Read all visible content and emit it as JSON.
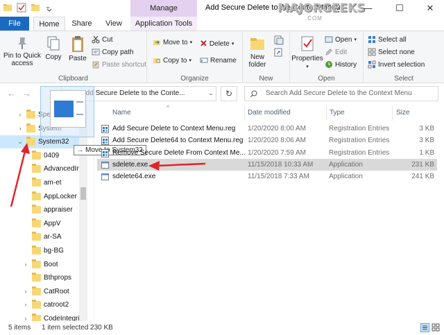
{
  "window": {
    "title": "Add Secure Delete to the Context Menu",
    "context_tab": "Manage",
    "watermark": "MAJORGEEKS",
    "watermark_sub": ".COM",
    "minimize": "—",
    "maximize": "☐",
    "close": "✕"
  },
  "tabs": {
    "file": "File",
    "home": "Home",
    "share": "Share",
    "view": "View",
    "app_tools": "Application Tools"
  },
  "ribbon": {
    "clipboard": {
      "label": "Clipboard",
      "pin": "Pin to Quick access",
      "copy": "Copy",
      "paste": "Paste",
      "cut": "Cut",
      "copy_path": "Copy path",
      "paste_shortcut": "Paste shortcut"
    },
    "organize": {
      "label": "Organize",
      "move_to": "Move to",
      "copy_to": "Copy to",
      "delete": "Delete",
      "rename": "Rename"
    },
    "new": {
      "label": "New",
      "new_folder": "New folder"
    },
    "open": {
      "label": "Open",
      "properties": "Properties",
      "open": "Open",
      "edit": "Edit",
      "history": "History"
    },
    "select": {
      "label": "Select",
      "select_all": "Select all",
      "select_none": "Select none",
      "invert": "Invert selection"
    }
  },
  "address": {
    "path": "Add Secure Delete to the Conte...",
    "search_placeholder": "Search Add Secure Delete to the Context Menu"
  },
  "nav_tree": [
    {
      "label": "Speech_One",
      "indent": 1,
      "expander": "›",
      "selected": false
    },
    {
      "label": "System",
      "indent": 1,
      "expander": "›",
      "selected": false
    },
    {
      "label": "System32",
      "indent": 1,
      "expander": "⌄",
      "selected": true
    },
    {
      "label": "0409",
      "indent": 2,
      "expander": "",
      "selected": false
    },
    {
      "label": "AdvancedIn",
      "indent": 2,
      "expander": "",
      "selected": false
    },
    {
      "label": "am-et",
      "indent": 2,
      "expander": "",
      "selected": false
    },
    {
      "label": "AppLocker",
      "indent": 2,
      "expander": "",
      "selected": false
    },
    {
      "label": "appraiser",
      "indent": 2,
      "expander": "",
      "selected": false
    },
    {
      "label": "AppV",
      "indent": 2,
      "expander": "",
      "selected": false
    },
    {
      "label": "ar-SA",
      "indent": 2,
      "expander": "",
      "selected": false
    },
    {
      "label": "bg-BG",
      "indent": 2,
      "expander": "",
      "selected": false
    },
    {
      "label": "Boot",
      "indent": 2,
      "expander": "›",
      "selected": false
    },
    {
      "label": "Bthprops",
      "indent": 2,
      "expander": "",
      "selected": false
    },
    {
      "label": "CatRoot",
      "indent": 2,
      "expander": "›",
      "selected": false
    },
    {
      "label": "catroot2",
      "indent": 2,
      "expander": "›",
      "selected": false
    },
    {
      "label": "CodeIntegri",
      "indent": 2,
      "expander": "›",
      "selected": false
    }
  ],
  "drag_tooltip": "Move to System32",
  "columns": {
    "name": "Name",
    "date": "Date modified",
    "type": "Type",
    "size": "Size"
  },
  "files": [
    {
      "name": "Add Secure Delete to Context Menu.reg",
      "date": "1/20/2020 8:00 AM",
      "type": "Registration Entries",
      "size": "3 KB",
      "icon": "registry-icon",
      "selected": false
    },
    {
      "name": "Add Secure Delete64 to Context Menu.reg",
      "date": "1/20/2020 8:06 AM",
      "type": "Registration Entries",
      "size": "3 KB",
      "icon": "registry-icon",
      "selected": false
    },
    {
      "name": "Remove Secure Delete From Context Me...",
      "date": "1/20/2020 7:59 AM",
      "type": "Registration Entries",
      "size": "1 KB",
      "icon": "registry-icon",
      "selected": false
    },
    {
      "name": "sdelete.exe",
      "date": "11/15/2018 10:33 AM",
      "type": "Application",
      "size": "231 KB",
      "icon": "application-icon",
      "selected": true
    },
    {
      "name": "sdelete64.exe",
      "date": "11/15/2018 7:33 AM",
      "type": "Application",
      "size": "241 KB",
      "icon": "application-icon",
      "selected": false
    }
  ],
  "status": {
    "items": "5 items",
    "selected": "1 item selected  230 KB"
  },
  "colors": {
    "accent": "#1a6bbf",
    "selection": "#cce8ff",
    "annotation_arrow": "#e0232a"
  }
}
